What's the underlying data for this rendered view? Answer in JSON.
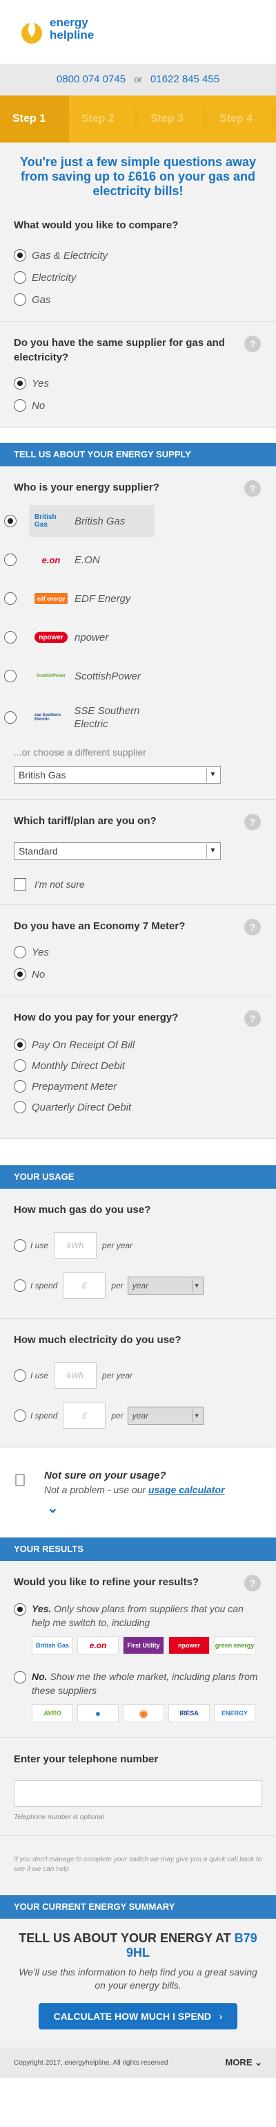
{
  "header": {
    "logo_line1": "energy",
    "logo_line2": "helpline",
    "phone1": "0800 074 0745",
    "or": "or",
    "phone2": "01622 845 455"
  },
  "steps": [
    "Step 1",
    "Step 2",
    "Step 3",
    "Step 4"
  ],
  "intro": "You're just a few simple questions away from saving up to £616 on your gas and electricity bills!",
  "compare": {
    "question": "What would you like to compare?",
    "options": [
      "Gas & Electricity",
      "Electricity",
      "Gas"
    ]
  },
  "same_supplier": {
    "question": "Do you have the same supplier for gas and electricity?",
    "options": [
      "Yes",
      "No"
    ]
  },
  "supply_section": "Tell us about your energy supply",
  "supplier": {
    "question": "Who is your energy supplier?",
    "items": [
      {
        "name": "British Gas",
        "logo": "British Gas"
      },
      {
        "name": "E.ON",
        "logo": "e.on"
      },
      {
        "name": "EDF Energy",
        "logo": "edf energy"
      },
      {
        "name": "npower",
        "logo": "npower"
      },
      {
        "name": "ScottishPower",
        "logo": "ScottishPower"
      },
      {
        "name": "SSE Southern Electric",
        "logo": "sse Southern Electric"
      }
    ],
    "choose_other": "...or choose a different supplier",
    "selected": "British Gas"
  },
  "tariff": {
    "question": "Which tariff/plan are you on?",
    "selected": "Standard",
    "not_sure": "I'm not sure"
  },
  "e7": {
    "question": "Do you have an Economy 7 Meter?",
    "options": [
      "Yes",
      "No"
    ]
  },
  "payment": {
    "question": "How do you pay for your energy?",
    "options": [
      "Pay On Receipt Of Bill",
      "Monthly Direct Debit",
      "Prepayment Meter",
      "Quarterly Direct Debit"
    ]
  },
  "usage_section": "Your usage",
  "gas_usage": {
    "question": "How much gas do you use?",
    "use_label": "I use",
    "kwh": "kWh",
    "per_year": "per year",
    "spend_label": "I spend",
    "pound": "£",
    "per": "per",
    "period": "year"
  },
  "elec_usage": {
    "question": "How much electricity do you use?",
    "use_label": "I use",
    "kwh": "kWh",
    "per_year": "per year",
    "spend_label": "I spend",
    "pound": "£",
    "per": "per",
    "period": "year"
  },
  "not_sure": {
    "title": "Not sure on your usage?",
    "text": "Not a problem - use our",
    "link": "usage calculator"
  },
  "results_section": "Your results",
  "refine": {
    "question": "Would you like to refine your results?",
    "yes_bold": "Yes.",
    "yes_text": "Only show plans from suppliers that you can help me switch to, including",
    "yes_logos": [
      "British Gas",
      "e.on",
      "First Utility",
      "npower",
      "green energy"
    ],
    "no_bold": "No.",
    "no_text": "Show me the whole market, including plans from these suppliers",
    "no_logos": [
      "AVRO",
      "●",
      "◉",
      "IRESA",
      "ENERGY"
    ]
  },
  "telephone": {
    "question": "Enter your telephone number",
    "note": "Telephone number is optional"
  },
  "disclaimer": "If you don't manage to complete your switch we may give you a quick call back to see if we can help",
  "summary_section": "Your current energy summary",
  "summary": {
    "title": "TELL US ABOUT YOUR ENERGY AT",
    "postcode": "B79 9HL",
    "text": "We'll use this information to help find you a great saving on your energy bills.",
    "cta": "CALCULATE HOW MUCH I SPEND"
  },
  "footer": {
    "copyright": "Copyright 2017, energyhelpline. All rights reserved",
    "more": "MORE"
  }
}
